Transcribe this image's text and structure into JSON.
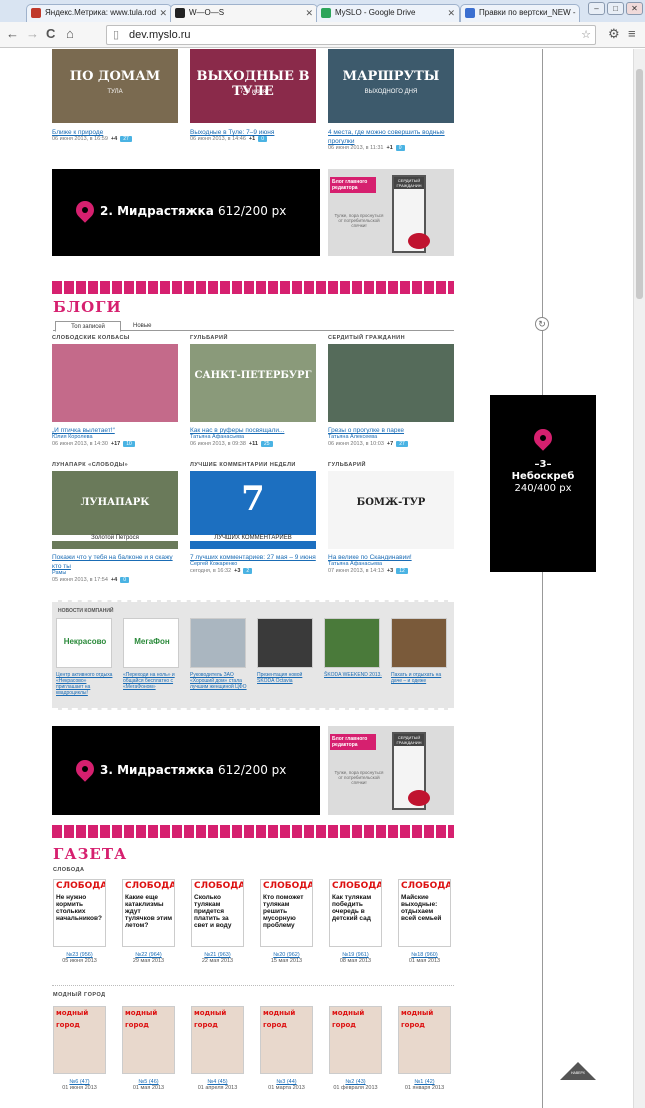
{
  "browser": {
    "tabs": [
      {
        "label": "Яндекс.Метрика: www.tula.rod",
        "active": false,
        "color": "#c0392b"
      },
      {
        "label": "W—O—S",
        "active": true,
        "color": "#222222"
      },
      {
        "label": "MySLO - Google Drive",
        "active": false,
        "color": "#2da55a"
      },
      {
        "label": "Правки по вертски_NEW -",
        "active": false,
        "color": "#3b6fd0"
      }
    ],
    "url": "dev.myslo.ru"
  },
  "top_row": [
    {
      "img_text": "ПО ДОМАМ",
      "img_sub": "ТУЛА",
      "title": "Ближе к природе",
      "meta": "06 июня 2013, в 16:59",
      "plus": "+4",
      "count": "27",
      "bg": "#7a6a50"
    },
    {
      "img_text": "ВЫХОДНЫЕ В ТУЛЕ",
      "img_sub": "7–9 июня",
      "title": "Выходные в Туле: 7–9 июня",
      "meta": "06 июня 2013, в 14:46",
      "plus": "+1",
      "count": "0",
      "bg": "#8a2a4a"
    },
    {
      "img_text": "МАРШРУТЫ",
      "img_sub": "ВЫХОДНОГО ДНЯ",
      "title": "4 места, где можно совершить водные прогулки",
      "meta": "06 июня 2013, в 11:31",
      "plus": "+1",
      "count": "0",
      "bg": "#3d5a6c"
    }
  ],
  "banner2": {
    "num": "2.",
    "name": "Мидрастяжка",
    "size": "612/200 px"
  },
  "banner3": {
    "num": "3.",
    "name": "Мидрастяжка",
    "size": "612/200 px"
  },
  "side_ad": {
    "tag": "Блог главного редактора",
    "door": "СЕРДИТЫЙ ГРАЖДАНИН",
    "note": "Тулке, пора проснуться от потребительской спячки!"
  },
  "sky": {
    "num": "–3–",
    "name": "Небоскреб",
    "size": "240/400 px"
  },
  "blogs": {
    "heading": "БЛОГИ",
    "tabs": [
      "Топ записей",
      "Новые"
    ],
    "row1": [
      {
        "section": "СЛОБОДСКИЕ КОЛБАСЫ",
        "title": "„И птичка вылетает!“",
        "author": "Юлия Королева",
        "meta": "06 июня 2013, в 14:30",
        "plus": "+17",
        "count": "10",
        "bg": "#c46a8a"
      },
      {
        "section": "ГУЛЬБАРИЙ",
        "title": "Как нас в руферы посвящали...",
        "author": "Татьяна Афанасьева",
        "meta": "06 июня 2013, в 09:38",
        "plus": "+11",
        "count": "25",
        "bg": "#8a9a7a",
        "img_text": "САНКТ-ПЕТЕРБУРГ"
      },
      {
        "section": "СЕРДИТЫЙ ГРАЖДАНИН",
        "title": "Грезы о прогулке в парке",
        "author": "Татьяна Алексеева",
        "meta": "06 июня 2013, в 10:03",
        "plus": "+7",
        "count": "27",
        "bg": "#556b5a"
      }
    ],
    "row2": [
      {
        "section": "ЛУНАПАРК «СЛОБОДЫ»",
        "title": "Покажи что у тебя на балконе и я скажу кто ты",
        "author": "Рамы",
        "meta": "05 июня 2013, в 17:54",
        "plus": "+4",
        "count": "0",
        "bg": "#6a7a5a",
        "img_text": "ЛУНАПАРК",
        "img_sub": "Золотой Петрося"
      },
      {
        "section": "ЛУЧШИЕ КОММЕНТАРИИ НЕДЕЛИ",
        "title": "7 лучших комментариев: 27 мая – 9 июня",
        "author": "Сергей Кожаренко",
        "meta": "сегодня, в 16:32",
        "plus": "+3",
        "count": "2",
        "bg": "#1c6fc0",
        "img_text": "7",
        "img_sub": "ЛУЧШИХ КОММЕНТАРИЕВ"
      },
      {
        "section": "ГУЛЬБАРИЙ",
        "title": "На велике по Скандинавии!",
        "author": "Татьяна Афанасьева",
        "meta": "07 июня 2013, в 14:13",
        "plus": "+3",
        "count": "12",
        "bg": "#f5f5f5",
        "img_text": "БОМЖ-ТУР"
      }
    ]
  },
  "company_news": {
    "heading": "НОВОСТИ КОМПАНИЙ",
    "items": [
      {
        "title": "Центр активного отдыха «Некрасово» приглашает на квадроциклы!",
        "logo": "Некрасово",
        "bg": "#fff"
      },
      {
        "title": "«Переходи на ноль» и общайся бесплатно с «МегаФоном»",
        "logo": "МегаФон",
        "bg": "#fff"
      },
      {
        "title": "Руководитель ЗАО «Хороший дом» стала лучшим женщиной ЦФО",
        "bg": "#aab6c0"
      },
      {
        "title": "Презентация новой SKODA Octavia",
        "bg": "#3a3a3a"
      },
      {
        "title": "ŠKODA WEEKEND 2013.",
        "bg": "#4a7a3a"
      },
      {
        "title": "Пахать и отдыхать на даче – и одеже",
        "bg": "#7a5a3a"
      }
    ]
  },
  "gazeta": {
    "heading": "ГАЗЕТА",
    "sub1": "СЛОБОДА",
    "sloboda": [
      {
        "no": "№23 (956)",
        "date": "05 июня 2013",
        "head": "Не нужно кормить стольких начальников?"
      },
      {
        "no": "№22 (964)",
        "date": "29 мая 2013",
        "head": "Какие еще катаклизмы ждут тулячков этим летом?"
      },
      {
        "no": "№21 (963)",
        "date": "22 мая 2013",
        "head": "Сколько тулякам придется платить за свет и воду"
      },
      {
        "no": "№20 (962)",
        "date": "15 мая 2013",
        "head": "Кто поможет тулякам решить мусорную проблему"
      },
      {
        "no": "№19 (961)",
        "date": "08 мая 2013",
        "head": "Как тулякам победить очередь в детский сад"
      },
      {
        "no": "№18 (960)",
        "date": "01 мая 2013",
        "head": "Майские выходные: отдыхаем всей семьей"
      }
    ],
    "sub2": "МОДНЫЙ ГОРОД",
    "modny": [
      {
        "no": "№6 (47)",
        "date": "01 июня 2013"
      },
      {
        "no": "№5 (46)",
        "date": "01 мая 2013"
      },
      {
        "no": "№4 (45)",
        "date": "01 апреля 2013"
      },
      {
        "no": "№3 (44)",
        "date": "01 марта 2013"
      },
      {
        "no": "№2 (43)",
        "date": "01 февраля 2013"
      },
      {
        "no": "№1 (42)",
        "date": "01 января 2013"
      }
    ],
    "logo_sloboda": "СЛОБОДА",
    "logo_modny": "модный город"
  },
  "totop": "НАВЕРХ"
}
